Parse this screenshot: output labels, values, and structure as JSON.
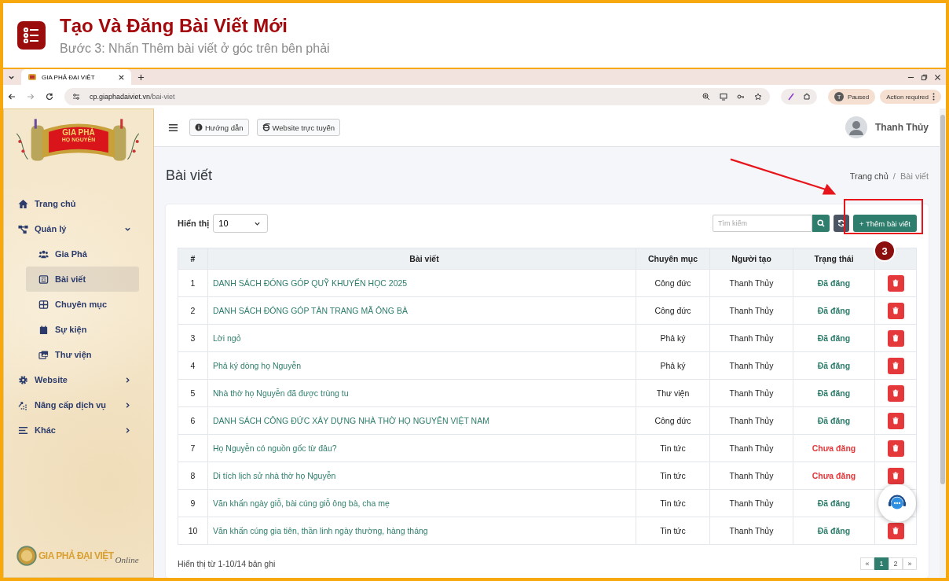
{
  "guide": {
    "title": "Tạo Và Đăng Bài Viết Mới",
    "subtitle": "Bước 3: Nhấn Thêm bài viết ở góc trên bên phải"
  },
  "browser": {
    "tab": "GIA PHẢ ĐẠI VIỆT",
    "url_host": "cp.giaphadaiviet.vn",
    "url_path": "/bai-viet",
    "profile_initial": "T",
    "profile_status": "Paused",
    "action": "Action required"
  },
  "sidebar": {
    "logo": {
      "line_1": "GIA PHẢ",
      "line_2": "HỌ NGUYỄN"
    },
    "items": [
      {
        "label": "Trang chủ",
        "selected": false
      },
      {
        "label": "Quản lý",
        "selected": false,
        "expanded": true,
        "children": [
          {
            "label": "Gia Phả",
            "selected": false
          },
          {
            "label": "Bài viết",
            "selected": true
          },
          {
            "label": "Chuyên mục",
            "selected": false
          },
          {
            "label": "Sự kiện",
            "selected": false
          },
          {
            "label": "Thư viện",
            "selected": false
          }
        ]
      },
      {
        "label": "Website",
        "selected": false,
        "expanded": false
      },
      {
        "label": "Nâng cấp dịch vụ",
        "selected": false,
        "expanded": false
      },
      {
        "label": "Khác",
        "selected": false,
        "expanded": false
      }
    ],
    "footer_logo": {
      "brand": "GIA PHẢ ĐẠI VIỆT",
      "suffix": "Online"
    }
  },
  "topbar": {
    "buttons": [
      "Hướng dẫn",
      "Website trực tuyến"
    ],
    "user": "Thanh Thủy"
  },
  "page": {
    "title": "Bài viết",
    "breadcrumb": [
      "Trang chủ",
      "Bài viết"
    ],
    "breadcrumb_separator": "/"
  },
  "toolbar": {
    "show_label": "Hiển thị",
    "page_size": "10",
    "search_placeholder": "Tìm kiếm",
    "add_button": "+ Thêm bài viết"
  },
  "table": {
    "columns": [
      "#",
      "Bài viết",
      "Chuyên mục",
      "Người tạo",
      "Trạng thái"
    ],
    "rows": [
      {
        "no": "1",
        "title": "DANH SÁCH ĐÓNG GÓP QUỸ KHUYẾN HỌC 2025",
        "category": "Công đức",
        "author": "Thanh Thủy",
        "status": "Đã đăng",
        "kind": "published"
      },
      {
        "no": "2",
        "title": "DANH SÁCH ĐÓNG GÓP TÂN TRANG MÃ ÔNG BÀ",
        "category": "Công đức",
        "author": "Thanh Thủy",
        "status": "Đã đăng",
        "kind": "published"
      },
      {
        "no": "3",
        "title": "Lời ngỏ",
        "category": "Phả ký",
        "author": "Thanh Thủy",
        "status": "Đã đăng",
        "kind": "published"
      },
      {
        "no": "4",
        "title": "Phả ký dòng họ Nguyễn",
        "category": "Phả ký",
        "author": "Thanh Thủy",
        "status": "Đã đăng",
        "kind": "published"
      },
      {
        "no": "5",
        "title": "Nhà thờ họ Nguyễn đã được trùng tu",
        "category": "Thư viện",
        "author": "Thanh Thủy",
        "status": "Đã đăng",
        "kind": "published"
      },
      {
        "no": "6",
        "title": "DANH SÁCH CÔNG ĐỨC XÂY DỰNG NHÀ THỜ HỌ NGUYỄN VIỆT NAM",
        "category": "Công đức",
        "author": "Thanh Thủy",
        "status": "Đã đăng",
        "kind": "published"
      },
      {
        "no": "7",
        "title": "Họ Nguyễn có nguồn gốc từ đâu?",
        "category": "Tin tức",
        "author": "Thanh Thủy",
        "status": "Chưa đăng",
        "kind": "draft"
      },
      {
        "no": "8",
        "title": "Di tích lịch sử nhà thờ họ Nguyễn",
        "category": "Tin tức",
        "author": "Thanh Thủy",
        "status": "Chưa đăng",
        "kind": "draft"
      },
      {
        "no": "9",
        "title": "Văn khấn ngày giỗ, bài cúng giỗ ông bà, cha mẹ",
        "category": "Tin tức",
        "author": "Thanh Thủy",
        "status": "Đã đăng",
        "kind": "published"
      },
      {
        "no": "10",
        "title": "Văn khấn cúng gia tiên, thần linh ngày thường, hàng tháng",
        "category": "Tin tức",
        "author": "Thanh Thủy",
        "status": "Đã đăng",
        "kind": "published"
      }
    ]
  },
  "footer": {
    "summary": "Hiển thị từ 1-10/14 bản ghi",
    "pages": [
      {
        "label": "«",
        "selected": false
      },
      {
        "label": "1",
        "selected": true
      },
      {
        "label": "2",
        "selected": false
      },
      {
        "label": "»",
        "selected": false
      }
    ]
  },
  "annotation": {
    "step": "3"
  }
}
